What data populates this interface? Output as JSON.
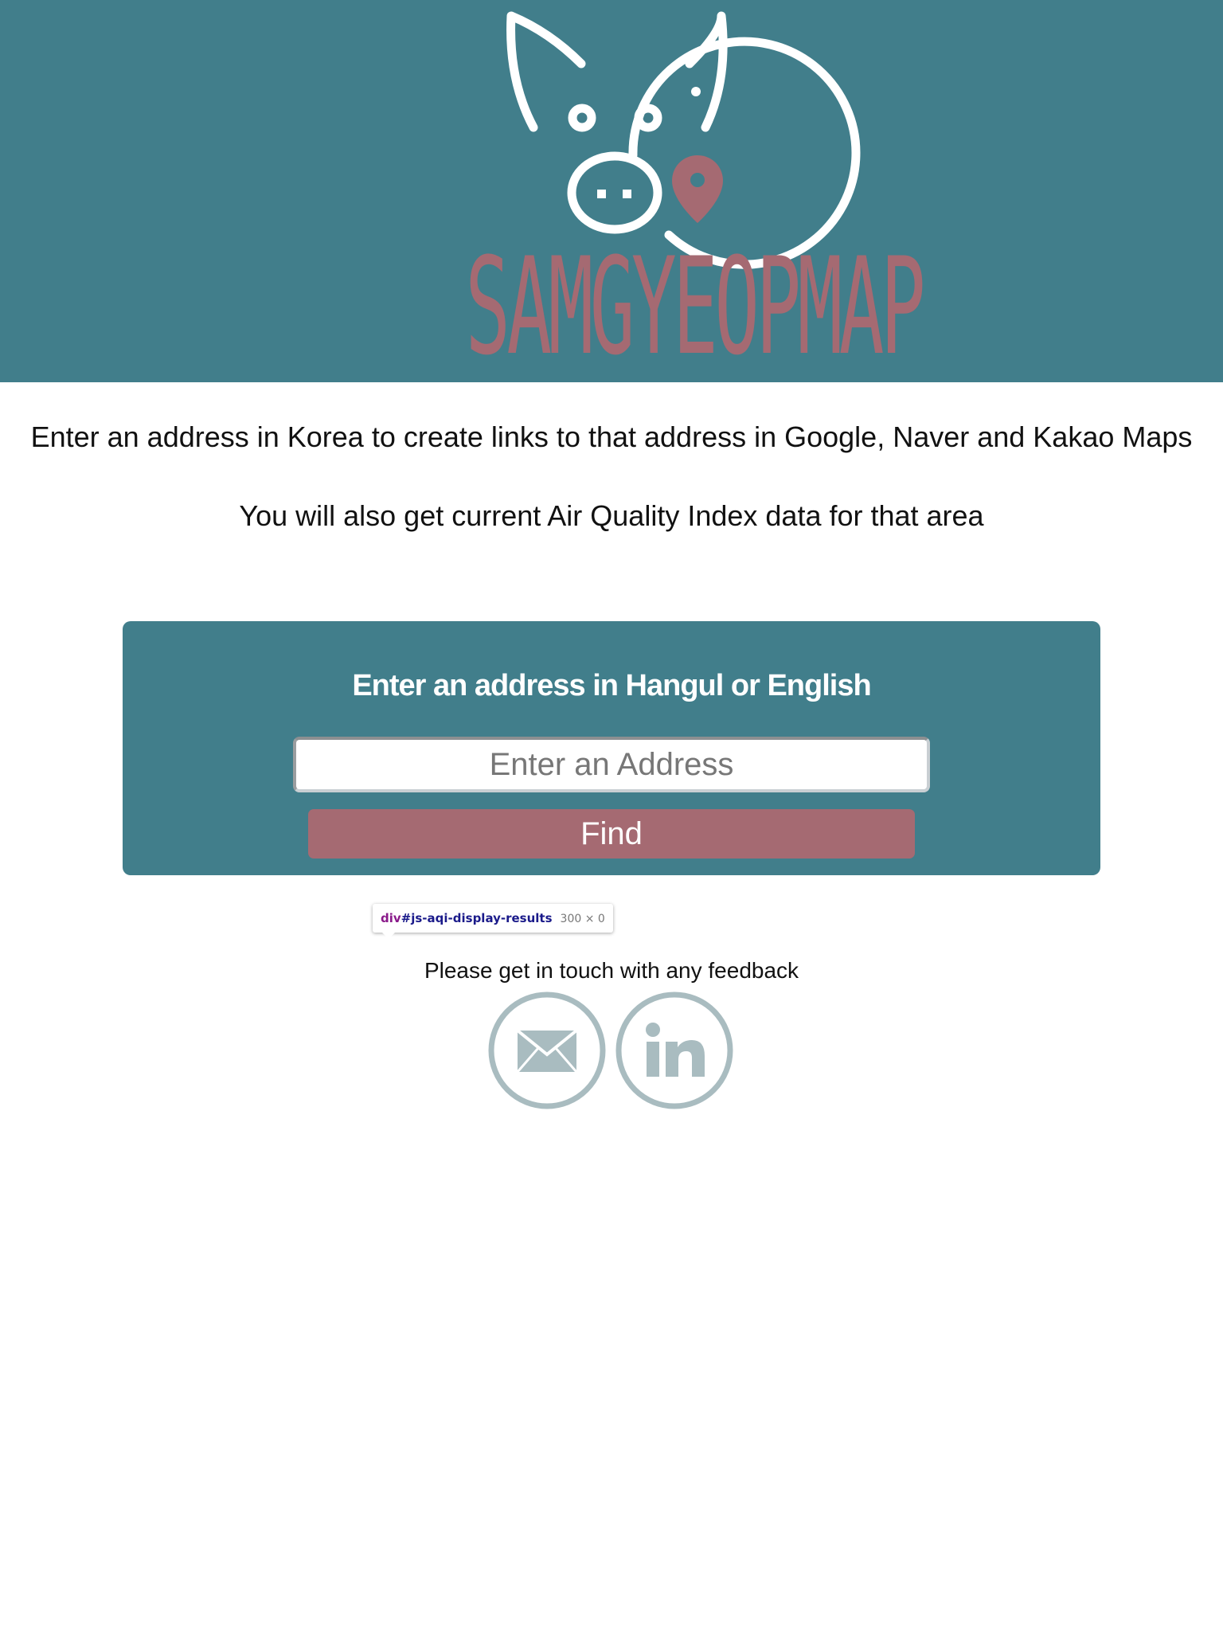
{
  "header": {
    "logo_text": "SAMGYEOPMAP",
    "icon": "pig-map-pin-icon",
    "colors": {
      "background": "#417e8b",
      "accent": "#a56a72",
      "icon": "#ffffff"
    }
  },
  "intro": {
    "line1": "Enter an address in Korea to create links to that address in Google, Naver and Kakao Maps",
    "line2": "You will also get current Air Quality Index data for that area"
  },
  "search": {
    "heading": "Enter an address in Hangul or English",
    "input_value": "",
    "placeholder": "Enter an Address",
    "button_label": "Find"
  },
  "inspector_tooltip": {
    "tag": "div",
    "id": "#js-aqi-display-results",
    "size": "300 × 0"
  },
  "footer": {
    "feedback_text": "Please get in touch with any feedback",
    "links": [
      {
        "icon": "envelope-icon"
      },
      {
        "icon": "linkedin-icon"
      }
    ]
  },
  "colors": {
    "panel": "#417e8b",
    "button": "#a56a72",
    "social_icons": "#a9bcc0",
    "text": "#111111"
  }
}
